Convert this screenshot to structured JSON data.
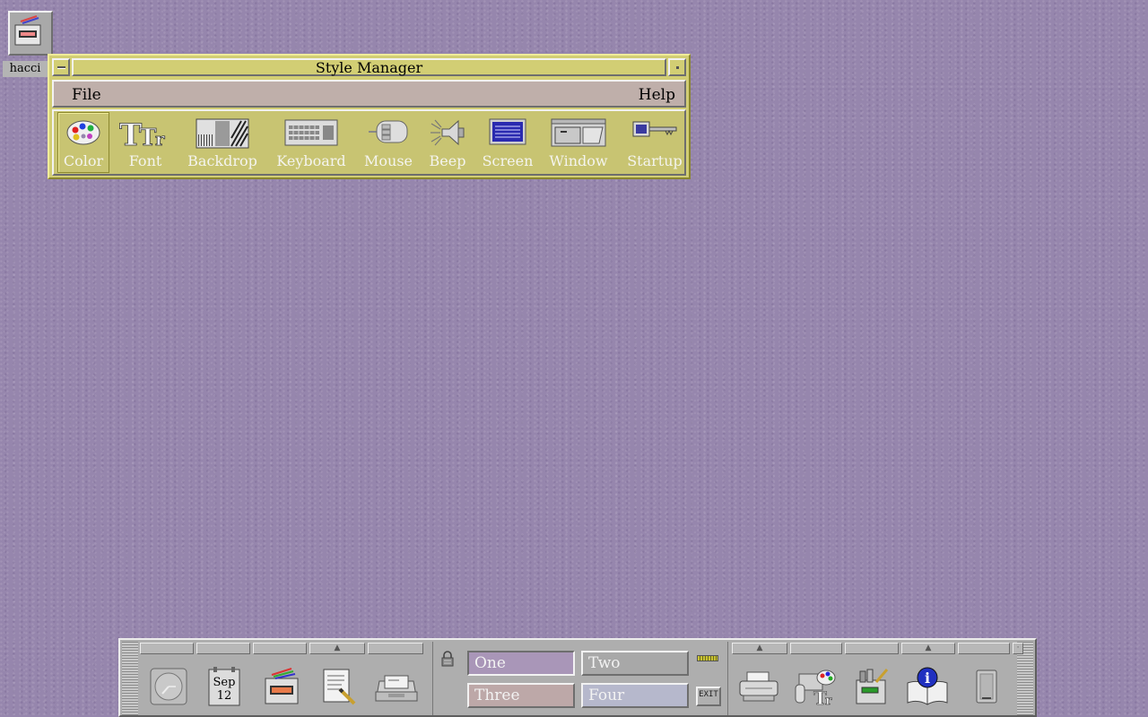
{
  "desktop_icon": {
    "label": "hacci",
    "icon": "style-manager-icon"
  },
  "window": {
    "title": "Style Manager",
    "menus": [
      "File",
      "Help"
    ],
    "tools": [
      {
        "label": "Color",
        "icon": "color-palette-icon",
        "selected": true
      },
      {
        "label": "Font",
        "icon": "font-icon"
      },
      {
        "label": "Backdrop",
        "icon": "backdrop-icon"
      },
      {
        "label": "Keyboard",
        "icon": "keyboard-icon"
      },
      {
        "label": "Mouse",
        "icon": "mouse-icon"
      },
      {
        "label": "Beep",
        "icon": "speaker-icon"
      },
      {
        "label": "Screen",
        "icon": "screen-icon"
      },
      {
        "label": "Window",
        "icon": "window-icon"
      },
      {
        "label": "Startup",
        "icon": "key-icon"
      }
    ]
  },
  "front_panel": {
    "left_icons": [
      "clock-icon",
      "calendar-icon",
      "file-manager-icon",
      "text-editor-icon",
      "mail-icon"
    ],
    "calendar": {
      "month": "Sep",
      "day": "12"
    },
    "workspaces": [
      "One",
      "Two",
      "Three",
      "Four"
    ],
    "exit_label": "EXIT",
    "right_icons": [
      "printer-icon",
      "style-manager-icon",
      "app-manager-icon",
      "help-icon",
      "trash-icon"
    ]
  },
  "colors": {
    "desktop": "#9686ad",
    "window_frame": "#d2ce74",
    "menubar": "#bfafaa",
    "panel": "#aeaeae",
    "ws_one": "#a996b8",
    "ws_two": "#a8a8a8",
    "ws_three": "#bda8a8",
    "ws_four": "#b6b8cc"
  }
}
